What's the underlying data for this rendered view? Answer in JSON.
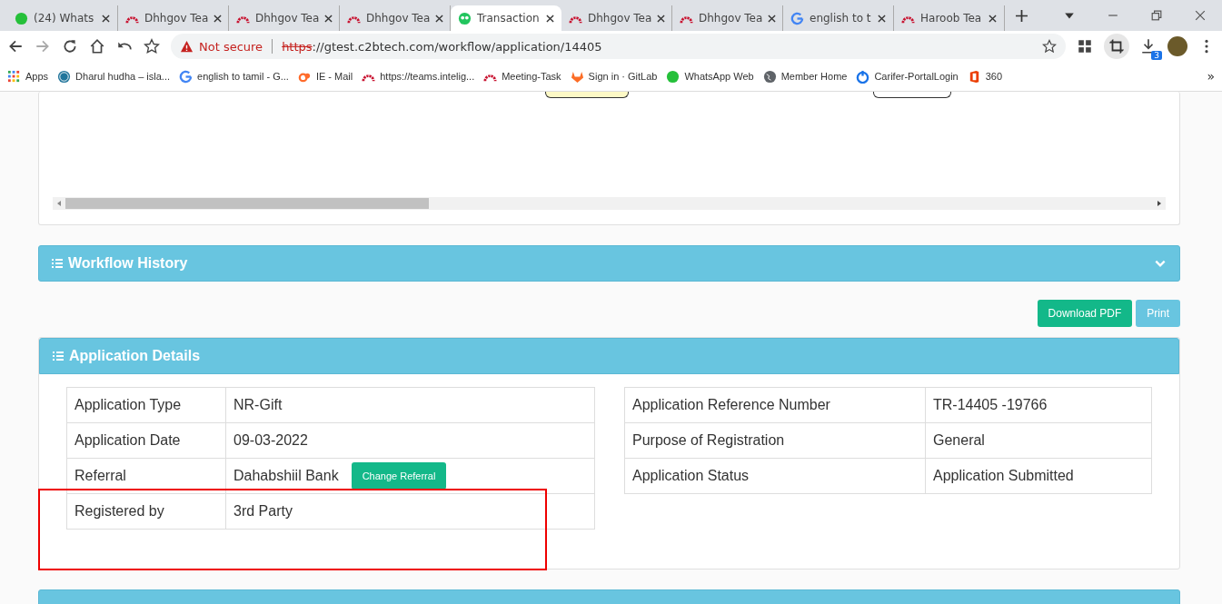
{
  "browser": {
    "tabs": [
      {
        "title": "(24) Whats",
        "kind": "whatsapp",
        "selected": false
      },
      {
        "title": "Dhhgov Tea",
        "kind": "arch",
        "selected": false
      },
      {
        "title": "Dhhgov Tea",
        "kind": "arch",
        "selected": false
      },
      {
        "title": "Dhhgov Tea",
        "kind": "arch",
        "selected": false
      },
      {
        "title": "Transaction",
        "kind": "owl",
        "selected": true
      },
      {
        "title": "Dhhgov Tea",
        "kind": "arch",
        "selected": false
      },
      {
        "title": "Dhhgov Tea",
        "kind": "arch",
        "selected": false
      },
      {
        "title": "english to t",
        "kind": "google",
        "selected": false
      },
      {
        "title": "Haroob Tea",
        "kind": "arch",
        "selected": false
      }
    ],
    "security": "Not secure",
    "url_scheme": "https",
    "url_rest": "://gtest.c2btech.com/workflow/application/14405",
    "downloads_badge": "3",
    "bookmarks": [
      {
        "label": "Apps",
        "kind": "apps"
      },
      {
        "label": "Dharul hudha – isla...",
        "kind": "wordpress"
      },
      {
        "label": "english to tamil - G...",
        "kind": "google"
      },
      {
        "label": "IE - Mail",
        "kind": "cpanel"
      },
      {
        "label": "https://teams.intelig...",
        "kind": "arch"
      },
      {
        "label": "Meeting-Task",
        "kind": "arch"
      },
      {
        "label": "Sign in · GitLab",
        "kind": "gitlab"
      },
      {
        "label": "WhatsApp Web",
        "kind": "whatsapp"
      },
      {
        "label": "Member Home",
        "kind": "globe"
      },
      {
        "label": "Carifer-PortalLogin",
        "kind": "drop"
      },
      {
        "label": "360",
        "kind": "office"
      }
    ],
    "overflow": "»"
  },
  "workflow_history": {
    "title": "Workflow History"
  },
  "actions": [
    "Download PDF",
    "Print"
  ],
  "application_details": {
    "title": "Application Details",
    "left_rows": [
      {
        "label": "Application Type",
        "value": "NR-Gift"
      },
      {
        "label": "Application Date",
        "value": "09-03-2022"
      },
      {
        "label": "Referral",
        "value": "Dahabshiil Bank",
        "button": "Change Referral"
      },
      {
        "label": "Registered by",
        "value": "3rd Party"
      }
    ],
    "right_rows": [
      {
        "label": "Application Reference Number",
        "value": "TR-14405 -19766"
      },
      {
        "label": "Purpose of Registration",
        "value": "General"
      },
      {
        "label": "Application Status",
        "value": "Application Submitted"
      }
    ]
  }
}
